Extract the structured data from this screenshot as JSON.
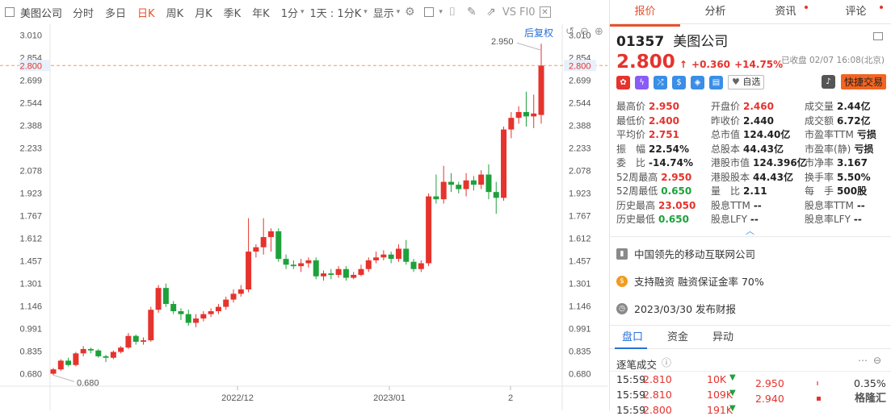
{
  "toolbar": {
    "title": "美图公司",
    "items": [
      "分时",
      "多日",
      "日K",
      "周K",
      "月K",
      "季K",
      "年K",
      "1分",
      "1天 : 1分K",
      "显示"
    ],
    "active": "日K",
    "vs_label": "VS",
    "f10_label": "FI0"
  },
  "chart": {
    "restore_label": "后复权",
    "high_label": "2.950",
    "low_label": "0.680",
    "current_price": "2.800",
    "y_ticks": [
      "3.010",
      "2.854",
      "2.699",
      "2.544",
      "2.388",
      "2.233",
      "2.078",
      "1.923",
      "1.767",
      "1.612",
      "1.457",
      "1.301",
      "1.146",
      "0.991",
      "0.835",
      "0.680"
    ],
    "x_ticks": [
      "2022/12",
      "2023/01",
      "2"
    ]
  },
  "chart_data": {
    "type": "candlestick",
    "ylim": [
      0.6,
      3.04
    ],
    "candles": [
      [
        0.68,
        0.71,
        0.67,
        0.72
      ],
      [
        0.71,
        0.77,
        0.7,
        0.78
      ],
      [
        0.77,
        0.74,
        0.73,
        0.79
      ],
      [
        0.74,
        0.82,
        0.73,
        0.83
      ],
      [
        0.82,
        0.85,
        0.8,
        0.87
      ],
      [
        0.85,
        0.84,
        0.82,
        0.86
      ],
      [
        0.84,
        0.8,
        0.79,
        0.85
      ],
      [
        0.8,
        0.79,
        0.76,
        0.81
      ],
      [
        0.79,
        0.83,
        0.78,
        0.84
      ],
      [
        0.83,
        0.86,
        0.82,
        0.87
      ],
      [
        0.86,
        0.94,
        0.85,
        0.96
      ],
      [
        0.94,
        0.9,
        0.88,
        0.95
      ],
      [
        0.9,
        0.91,
        0.88,
        0.93
      ],
      [
        0.91,
        1.12,
        0.9,
        1.14
      ],
      [
        1.12,
        1.27,
        1.1,
        1.29
      ],
      [
        1.27,
        1.16,
        1.14,
        1.3
      ],
      [
        1.16,
        1.11,
        1.09,
        1.18
      ],
      [
        1.11,
        1.09,
        1.05,
        1.13
      ],
      [
        1.09,
        1.03,
        1.01,
        1.12
      ],
      [
        1.03,
        1.06,
        1.0,
        1.09
      ],
      [
        1.06,
        1.09,
        1.04,
        1.11
      ],
      [
        1.09,
        1.11,
        1.07,
        1.13
      ],
      [
        1.11,
        1.14,
        1.09,
        1.16
      ],
      [
        1.14,
        1.19,
        1.12,
        1.21
      ],
      [
        1.19,
        1.23,
        1.17,
        1.26
      ],
      [
        1.23,
        1.26,
        1.21,
        1.29
      ],
      [
        1.26,
        1.52,
        1.24,
        1.75
      ],
      [
        1.52,
        1.55,
        1.48,
        1.57
      ],
      [
        1.55,
        1.62,
        1.5,
        1.75
      ],
      [
        1.62,
        1.66,
        1.52,
        1.68
      ],
      [
        1.66,
        1.47,
        1.45,
        1.68
      ],
      [
        1.47,
        1.43,
        1.4,
        1.5
      ],
      [
        1.43,
        1.42,
        1.4,
        1.46
      ],
      [
        1.42,
        1.44,
        1.38,
        1.47
      ],
      [
        1.44,
        1.46,
        1.41,
        1.48
      ],
      [
        1.46,
        1.35,
        1.33,
        1.48
      ],
      [
        1.35,
        1.37,
        1.32,
        1.39
      ],
      [
        1.37,
        1.36,
        1.33,
        1.4
      ],
      [
        1.36,
        1.4,
        1.34,
        1.42
      ],
      [
        1.4,
        1.34,
        1.32,
        1.42
      ],
      [
        1.34,
        1.36,
        1.33,
        1.38
      ],
      [
        1.36,
        1.4,
        1.35,
        1.43
      ],
      [
        1.4,
        1.46,
        1.38,
        1.48
      ],
      [
        1.46,
        1.48,
        1.44,
        1.52
      ],
      [
        1.48,
        1.5,
        1.46,
        1.53
      ],
      [
        1.5,
        1.47,
        1.44,
        1.52
      ],
      [
        1.47,
        1.54,
        1.45,
        1.57
      ],
      [
        1.54,
        1.45,
        1.43,
        1.6
      ],
      [
        1.45,
        1.4,
        1.38,
        1.47
      ],
      [
        1.4,
        1.44,
        1.38,
        1.46
      ],
      [
        1.44,
        1.9,
        1.42,
        1.92
      ],
      [
        1.9,
        1.88,
        1.85,
        2.05
      ],
      [
        1.88,
        2.0,
        1.85,
        2.11
      ],
      [
        2.0,
        1.98,
        1.93,
        2.06
      ],
      [
        1.98,
        1.95,
        1.92,
        2.0
      ],
      [
        1.95,
        2.01,
        1.9,
        2.06
      ],
      [
        2.01,
        1.98,
        1.94,
        2.04
      ],
      [
        1.98,
        2.05,
        1.95,
        2.08
      ],
      [
        2.05,
        1.93,
        1.88,
        2.12
      ],
      [
        1.93,
        1.89,
        1.78,
        2.0
      ],
      [
        1.89,
        2.36,
        1.87,
        2.38
      ],
      [
        2.36,
        2.44,
        2.3,
        2.48
      ],
      [
        2.44,
        2.48,
        2.4,
        2.52
      ],
      [
        2.48,
        2.45,
        2.38,
        2.62
      ],
      [
        2.45,
        2.47,
        2.37,
        2.6
      ],
      [
        2.46,
        2.8,
        2.4,
        2.95
      ]
    ]
  },
  "quote": {
    "code": "01357",
    "name": "美图公司",
    "price": "2.800",
    "arrow": "↑",
    "change": "+0.360",
    "change_pct": "+14.75%",
    "status": "已收盘 02/07 16:08(北京)",
    "watch_label": "自选",
    "quick_trade": "快捷交易"
  },
  "tabs": [
    "报价",
    "分析",
    "资讯",
    "评论"
  ],
  "stats": [
    [
      {
        "l": "最高价",
        "v": "2.950",
        "c": "red"
      },
      {
        "l": "开盘价",
        "v": "2.460",
        "c": "red"
      },
      {
        "l": "成交量",
        "v": "2.44亿",
        "c": ""
      }
    ],
    [
      {
        "l": "最低价",
        "v": "2.400",
        "c": "red"
      },
      {
        "l": "昨收价",
        "v": "2.440",
        "c": ""
      },
      {
        "l": "成交额",
        "v": "6.72亿",
        "c": ""
      }
    ],
    [
      {
        "l": "平均价",
        "v": "2.751",
        "c": "red"
      },
      {
        "l": "总市值",
        "v": "124.40亿",
        "c": ""
      },
      {
        "l": "市盈率TTM",
        "v": "亏损",
        "c": ""
      }
    ],
    [
      {
        "l": "振　幅",
        "v": "22.54%",
        "c": ""
      },
      {
        "l": "总股本",
        "v": "44.43亿",
        "c": ""
      },
      {
        "l": "市盈率(静)",
        "v": "亏损",
        "c": ""
      }
    ],
    [
      {
        "l": "委　比",
        "v": "-14.74%",
        "c": ""
      },
      {
        "l": "港股市值",
        "v": "124.396亿",
        "c": ""
      },
      {
        "l": "市净率",
        "v": "3.167",
        "c": ""
      }
    ],
    [
      {
        "l": "52周最高",
        "v": "2.950",
        "c": "red"
      },
      {
        "l": "港股股本",
        "v": "44.43亿",
        "c": ""
      },
      {
        "l": "换手率",
        "v": "5.50%",
        "c": ""
      }
    ],
    [
      {
        "l": "52周最低",
        "v": "0.650",
        "c": "green"
      },
      {
        "l": "量　比",
        "v": "2.11",
        "c": ""
      },
      {
        "l": "每　手",
        "v": "500股",
        "c": ""
      }
    ],
    [
      {
        "l": "历史最高",
        "v": "23.050",
        "c": "red"
      },
      {
        "l": "股息TTM",
        "v": "--",
        "c": ""
      },
      {
        "l": "股息率TTM",
        "v": "--",
        "c": ""
      }
    ],
    [
      {
        "l": "历史最低",
        "v": "0.650",
        "c": "green"
      },
      {
        "l": "股息LFY",
        "v": "--",
        "c": ""
      },
      {
        "l": "股息率LFY",
        "v": "--",
        "c": ""
      }
    ]
  ],
  "info": {
    "desc": "中国领先的移动互联网公司",
    "margin": "支持融资 融资保证金率 70%",
    "report": "2023/03/30  发布财报"
  },
  "bottom_tabs": [
    "盘口",
    "资金",
    "异动"
  ],
  "trades_title": "逐笔成交",
  "trades": [
    {
      "time": "15:59",
      "price": "2.810",
      "vol": "10K"
    },
    {
      "time": "15:59",
      "price": "2.810",
      "vol": "109K"
    },
    {
      "time": "15:59",
      "price": "2.800",
      "vol": "191K"
    }
  ],
  "depth": [
    {
      "price": "2.950",
      "pct": "0.35%"
    },
    {
      "price": "2.940",
      "pct": ""
    }
  ],
  "watermark": "格隆汇",
  "colors": {
    "up": "#e5332d",
    "down": "#1ea13b",
    "accent": "#e5532d"
  }
}
